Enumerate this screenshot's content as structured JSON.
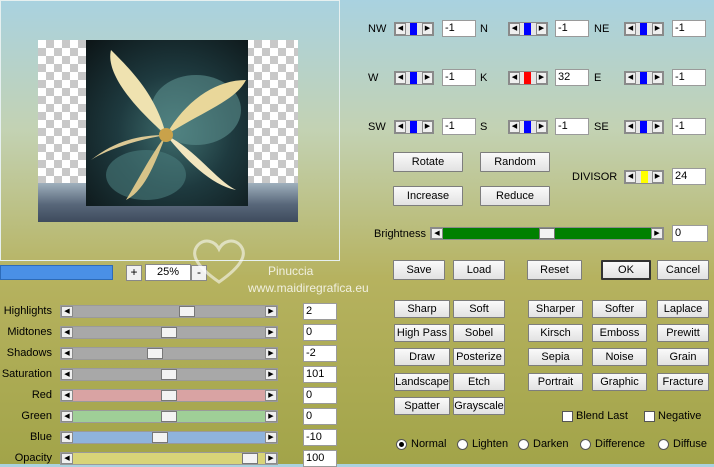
{
  "preview": {
    "zoom": "25%",
    "zoom_in": "+",
    "zoom_out": "-"
  },
  "watermark": {
    "name": "Pinuccia",
    "url": "www.maidiregrafica.eu"
  },
  "sliders": [
    {
      "label": "Highlights",
      "value": "2",
      "color": "#a8a8a8",
      "pos": 0.6
    },
    {
      "label": "Midtones",
      "value": "0",
      "color": "#a8a8a8",
      "pos": 0.5
    },
    {
      "label": "Shadows",
      "value": "-2",
      "color": "#a8a8a8",
      "pos": 0.42
    },
    {
      "label": "Saturation",
      "value": "101",
      "color": "#a8a8a8",
      "pos": 0.5
    },
    {
      "label": "Red",
      "value": "0",
      "color": "#d9a3a3",
      "pos": 0.5
    },
    {
      "label": "Green",
      "value": "0",
      "color": "#9fcf97",
      "pos": 0.5
    },
    {
      "label": "Blue",
      "value": "-10",
      "color": "#8fb3dc",
      "pos": 0.45
    },
    {
      "label": "Opacity",
      "value": "100",
      "color": "#d8d478",
      "pos": 0.96
    }
  ],
  "matrix": [
    {
      "label": "NW",
      "value": "-1",
      "color": "#0000ff"
    },
    {
      "label": "N",
      "value": "-1",
      "color": "#0000ff"
    },
    {
      "label": "NE",
      "value": "-1",
      "color": "#0000ff"
    },
    {
      "label": "W",
      "value": "-1",
      "color": "#0000ff"
    },
    {
      "label": "K",
      "value": "32",
      "color": "#ff0000"
    },
    {
      "label": "E",
      "value": "-1",
      "color": "#0000ff"
    },
    {
      "label": "SW",
      "value": "-1",
      "color": "#0000ff"
    },
    {
      "label": "S",
      "value": "-1",
      "color": "#0000ff"
    },
    {
      "label": "SE",
      "value": "-1",
      "color": "#0000ff"
    }
  ],
  "ops": {
    "rotate": "Rotate",
    "random": "Random",
    "increase": "Increase",
    "reduce": "Reduce"
  },
  "divisor": {
    "label": "DIVISOR",
    "value": "24",
    "color": "#ffff00"
  },
  "brightness": {
    "label": "Brightness",
    "value": "0",
    "color": "#008000",
    "pos": 0.5
  },
  "actions": {
    "save": "Save",
    "load": "Load",
    "reset": "Reset",
    "ok": "OK",
    "cancel": "Cancel"
  },
  "presets": [
    [
      "Sharp",
      "Soft",
      "Sharper",
      "Softer",
      "Laplace"
    ],
    [
      "High Pass",
      "Sobel",
      "Kirsch",
      "Emboss",
      "Prewitt"
    ],
    [
      "Draw",
      "Posterize",
      "Sepia",
      "Noise",
      "Grain"
    ],
    [
      "Landscape",
      "Etch",
      "Portrait",
      "Graphic",
      "Fracture"
    ],
    [
      "Spatter",
      "Grayscale"
    ]
  ],
  "options": {
    "blend_last": "Blend Last",
    "negative": "Negative"
  },
  "modes": [
    "Normal",
    "Lighten",
    "Darken",
    "Difference",
    "Diffuse"
  ],
  "selected_mode": "Normal"
}
